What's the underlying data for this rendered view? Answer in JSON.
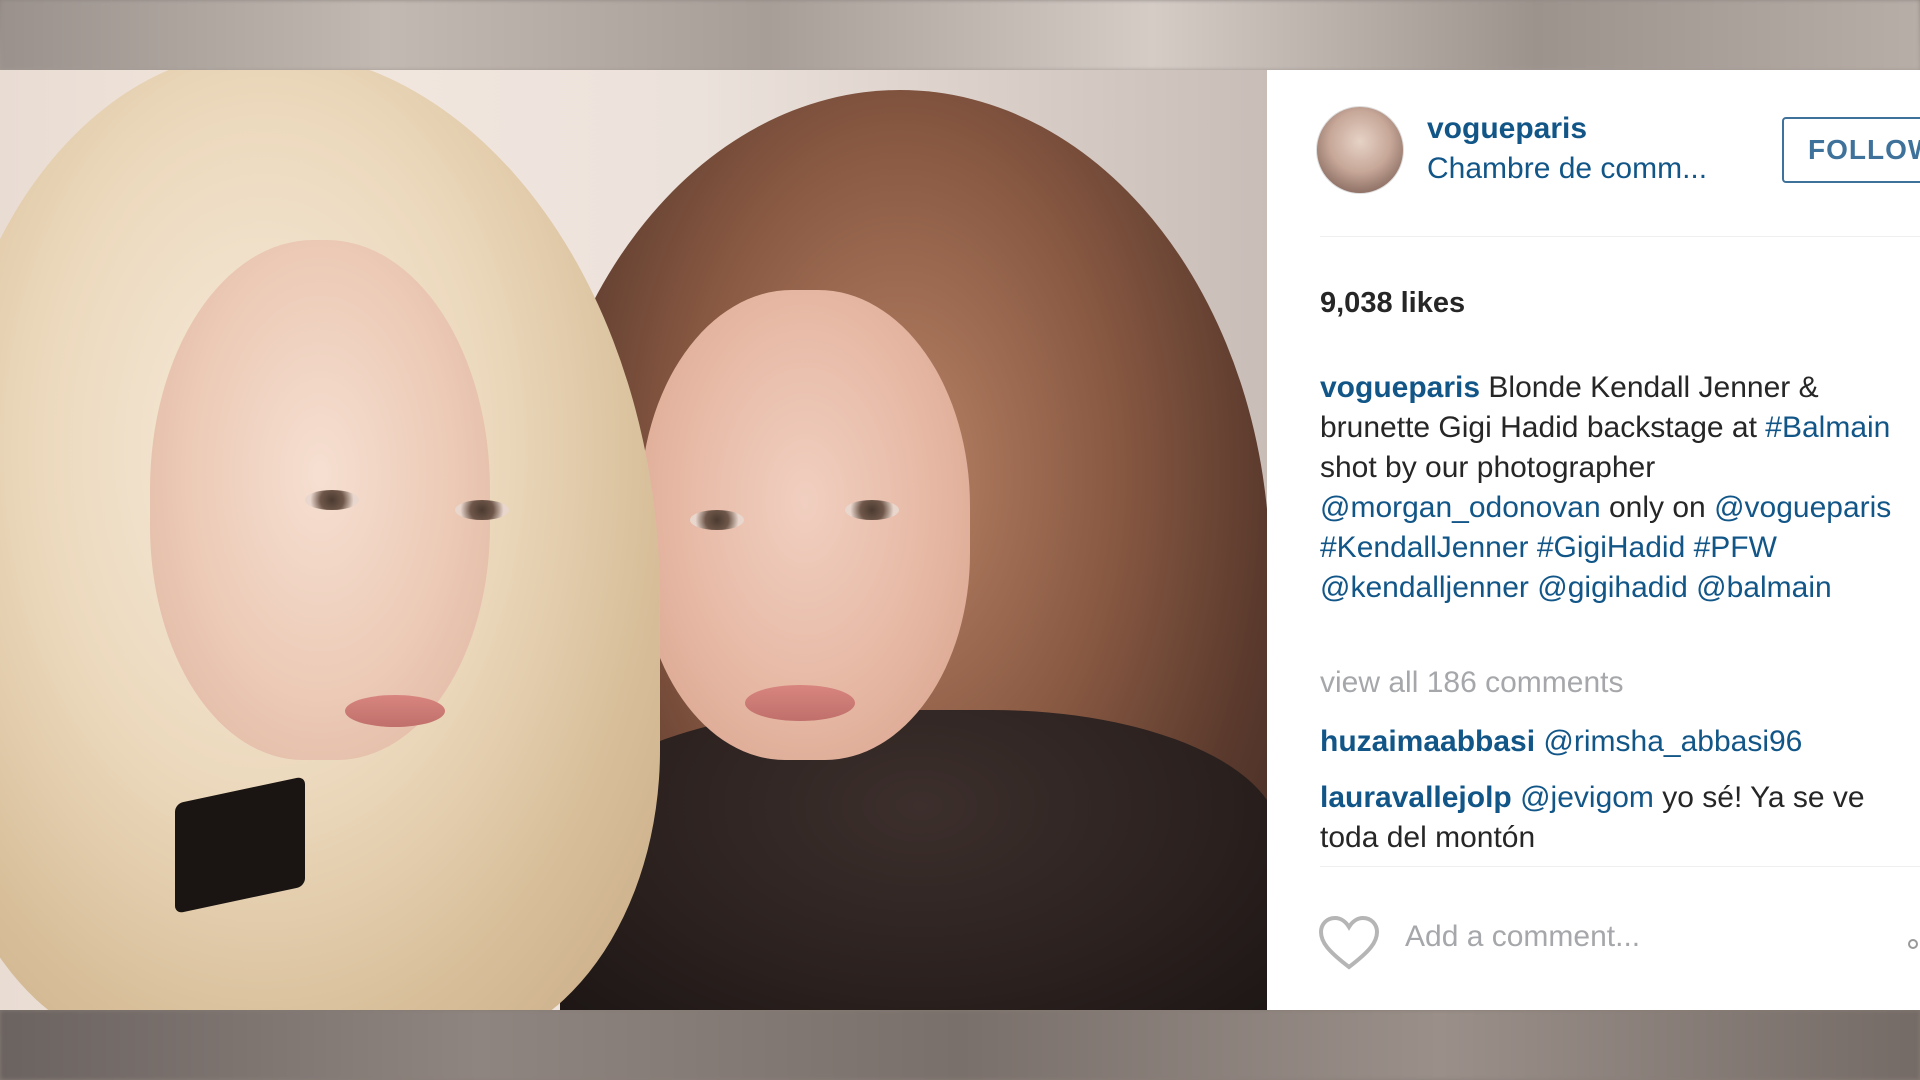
{
  "post": {
    "username": "vogueparis",
    "location": "Chambre de comm...",
    "follow_label": "FOLLOW",
    "likes": "9,038 likes",
    "caption": {
      "user": "vogueparis",
      "text_1": " Blonde Kendall Jenner & brunette Gigi Hadid backstage at ",
      "tag_balmain": "#Balmain",
      "text_2": " shot by our photographer ",
      "mention_photographer": "@morgan_odonovan",
      "text_3": " only on ",
      "mention_vogue": "@vogueparis",
      "tag_kendall": "#KendallJenner",
      "tag_gigi": "#GigiHadid",
      "tag_pfw": "#PFW",
      "mention_kendall": "@kendalljenner",
      "mention_gigi": "@gigihadid",
      "mention_balmain": "@balmain"
    },
    "view_all_comments": "view all 186 comments",
    "comments": [
      {
        "user": "huzaimaabbasi",
        "mention": "@rimsha_abbasi96",
        "text": ""
      },
      {
        "user": "lauravallejolp",
        "mention": "@jevigom",
        "text": " yo sé! Ya se ve toda del montón"
      }
    ],
    "add_comment_placeholder": "Add a comment...",
    "icons": {
      "like": "heart-icon",
      "more": "more-options-icon"
    }
  }
}
